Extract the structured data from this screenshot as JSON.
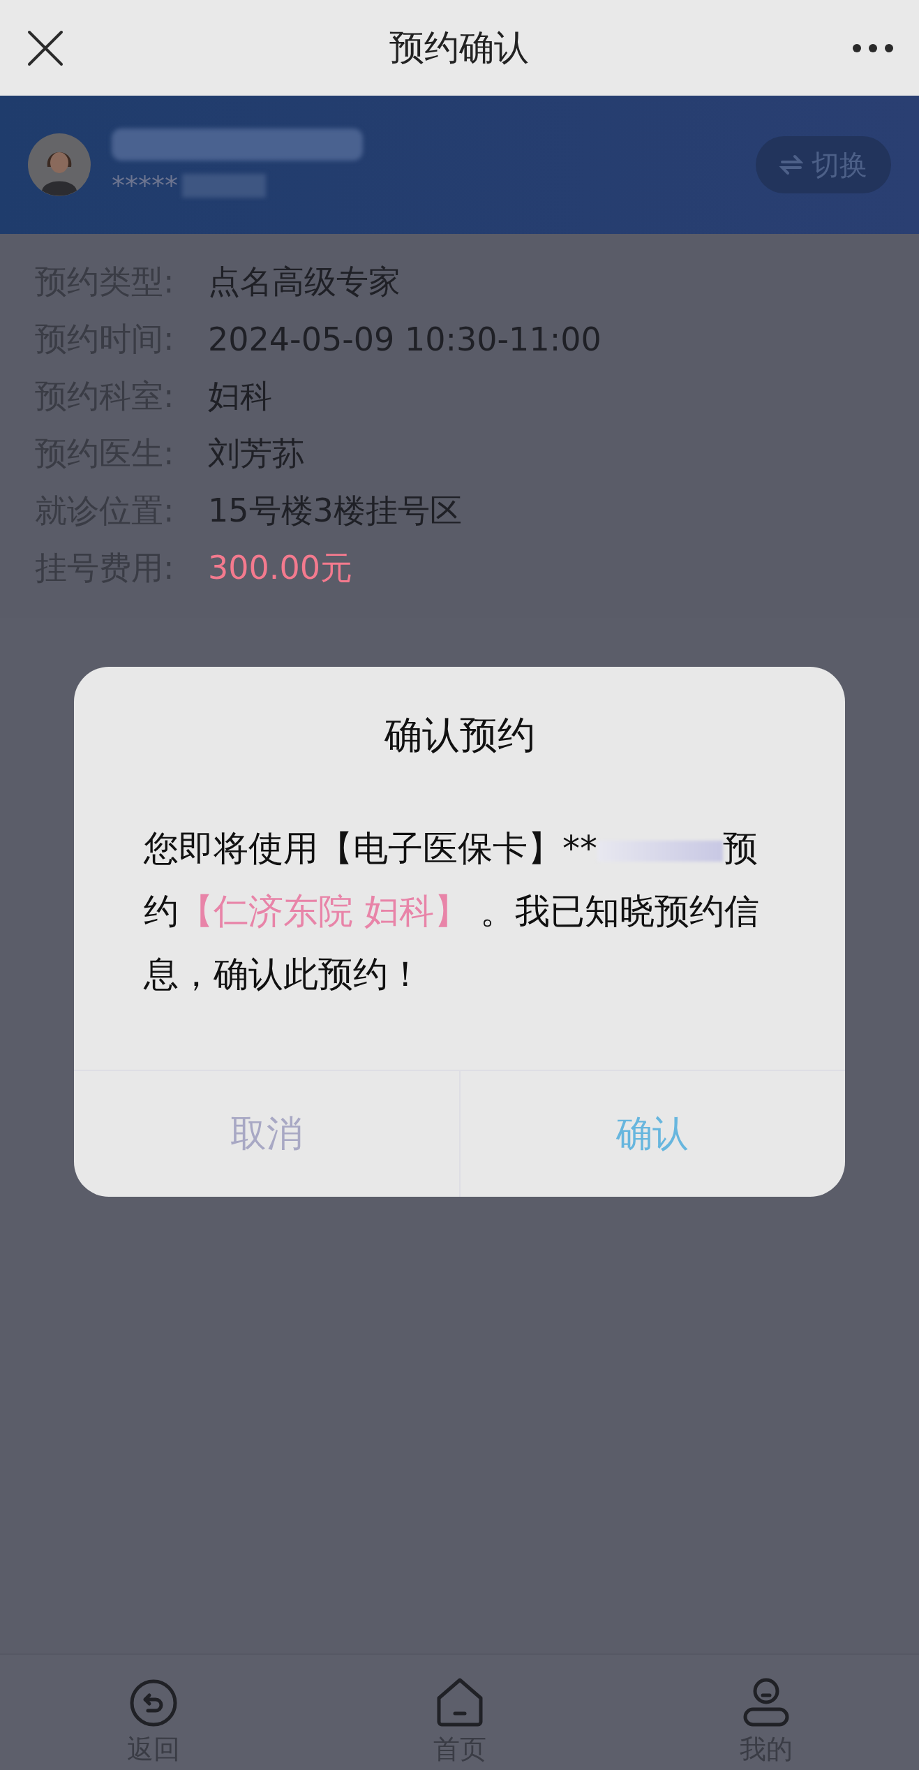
{
  "top_bar": {
    "title": "预约确认"
  },
  "patient": {
    "masked_id": "*****",
    "switch_label": "切换"
  },
  "details": [
    {
      "label": "预约类型:",
      "value": "点名高级专家",
      "kind": "plain"
    },
    {
      "label": "预约时间:",
      "value": "2024-05-09 10:30-11:00",
      "kind": "plain"
    },
    {
      "label": "预约科室:",
      "value": "妇科",
      "kind": "plain"
    },
    {
      "label": "预约医生:",
      "value": "刘芳荪",
      "kind": "plain"
    },
    {
      "label": "就诊位置:",
      "value": "15号楼3楼挂号区",
      "kind": "plain"
    },
    {
      "label": "挂号费用:",
      "value": "300.00元",
      "kind": "fee"
    }
  ],
  "dialog": {
    "title": "确认预约",
    "message": [
      {
        "text": "您即将使用【电子医保卡】**",
        "kind": "plain"
      },
      {
        "kind": "redacted"
      },
      {
        "text": "预约",
        "kind": "plain"
      },
      {
        "text": "【仁济东院 妇科】",
        "kind": "highlight"
      },
      {
        "text": " 。我已知晓预约信息，确认此预约！",
        "kind": "plain"
      }
    ],
    "buttons": [
      {
        "label": "取消",
        "kind": "cancel"
      },
      {
        "label": "确认",
        "kind": "confirm"
      }
    ]
  },
  "bottom_nav": [
    {
      "label": "返回",
      "kind": "back"
    },
    {
      "label": "首页",
      "kind": "home"
    },
    {
      "label": "我的",
      "kind": "profile"
    }
  ]
}
